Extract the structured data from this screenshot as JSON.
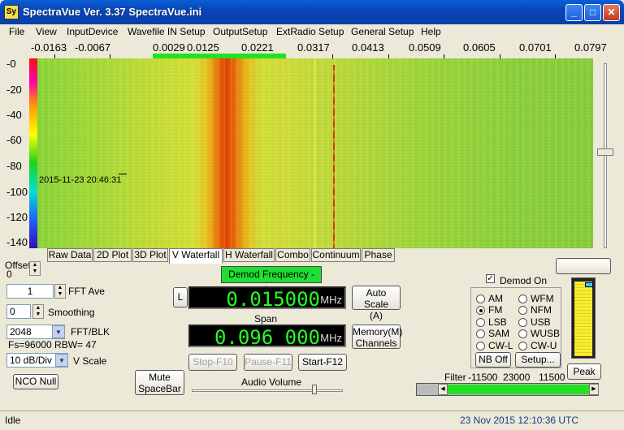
{
  "window": {
    "title": "SpectraVue Ver. 3.37 SpectraVue.ini",
    "icon_text": "Sy"
  },
  "menu": [
    "File",
    "View",
    "InputDevice",
    "Wavefile IN Setup",
    "OutputSetup",
    "ExtRadio Setup",
    "General Setup",
    "Help"
  ],
  "freq_axis": [
    "-0.0163",
    "-0.0067",
    "0.0029",
    "0.0125",
    "0.0221",
    "0.0317",
    "0.0413",
    "0.0509",
    "0.0605",
    "0.0701",
    "0.0797"
  ],
  "db_axis": [
    "-0",
    "-20",
    "-40",
    "-60",
    "-80",
    "-100",
    "-120",
    "-140"
  ],
  "waterfall": {
    "timestamp": "2015-11-23 20:46:31"
  },
  "tabs": [
    "Raw Data",
    "2D Plot",
    "3D Plot",
    "V Waterfall",
    "H Waterfall",
    "Combo",
    "Continuum",
    "Phase"
  ],
  "active_tab": "V Waterfall",
  "left_controls": {
    "offset_label": "Offset",
    "offset_value": "0",
    "fft_ave_value": "1",
    "fft_ave_label": "FFT Ave",
    "smoothing_value": "0",
    "smoothing_label": "Smoothing",
    "fft_blk_value": "2048",
    "fft_blk_label": "FFT/BLK",
    "fs_text": "Fs=96000 RBW=  47",
    "vscale_value": "10 dB/Div",
    "vscale_label": "V Scale",
    "nco_null": "NCO Null",
    "mute": "Mute\nSpaceBar"
  },
  "center": {
    "demod_freq_button": "Demod Frequency - Ins",
    "l_button": "L",
    "demod_freq_digits": "0.015000",
    "demod_freq_unit": "MHz",
    "span_label": "Span",
    "span_digits": "0.096 000",
    "span_unit": "MHz",
    "auto_scale": "Auto Scale\n(A)",
    "memory": "Memory(M)\nChannels",
    "stop": "Stop-F10",
    "pause": "Pause-F11",
    "start": "Start-F12",
    "audio_volume_label": "Audio Volume"
  },
  "demod": {
    "on_label": "Demod On",
    "on_checked": true,
    "modes_left": [
      "AM",
      "FM",
      "LSB",
      "SAM",
      "CW-L"
    ],
    "modes_right": [
      "WFM",
      "NFM",
      "USB",
      "WUSB",
      "CW-U"
    ],
    "selected": "FM",
    "nb_off": "NB Off",
    "setup": "Setup..."
  },
  "peak": "Peak",
  "filter": {
    "label": "Filter",
    "low": "-11500",
    "width": "23000",
    "high": "11500"
  },
  "status": {
    "left": "Idle",
    "right": "23 Nov 2015  12:10:36 UTC"
  },
  "colors": {
    "lcd_digits": "#22ff22",
    "accent_green": "#22e022",
    "title_blue": "#0a4fc8"
  }
}
